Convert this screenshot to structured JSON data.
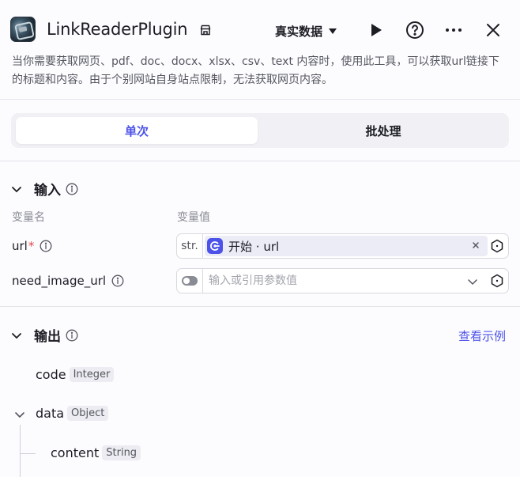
{
  "header": {
    "title": "LinkReaderPlugin",
    "mode_label": "真实数据",
    "description": "当你需要获取网页、pdf、doc、docx、xlsx、csv、text 内容时，使用此工具，可以获取url链接下的标题和内容。由于个别网站自身站点限制，无法获取网页内容。"
  },
  "tabs": [
    {
      "label": "单次",
      "active": true
    },
    {
      "label": "批处理",
      "active": false
    }
  ],
  "input_section": {
    "title": "输入",
    "col_name_label": "变量名",
    "col_value_label": "变量值",
    "params": [
      {
        "name": "url",
        "required_mark": "*",
        "type_label": "str.",
        "ref_source": "开始",
        "ref_separator": " · ",
        "ref_field": "url"
      },
      {
        "name": "need_image_url",
        "placeholder": "输入或引用参数值",
        "value": ""
      }
    ]
  },
  "output_section": {
    "title": "输出",
    "example_link": "查看示例",
    "fields": [
      {
        "name": "code",
        "type": "Integer"
      },
      {
        "name": "data",
        "type": "Object"
      },
      {
        "name": "content",
        "type": "String"
      }
    ]
  },
  "colors": {
    "accent": "#4d53e8",
    "required": "#e5484d",
    "text": "#1c1d23",
    "muted": "#8a8c95"
  },
  "icons": [
    "plugin-logo",
    "store-icon",
    "play-icon",
    "help-icon",
    "more-icon",
    "close-icon",
    "chevron-down-icon",
    "info-icon",
    "variable-ref-icon",
    "clear-icon",
    "toggle-icon"
  ]
}
